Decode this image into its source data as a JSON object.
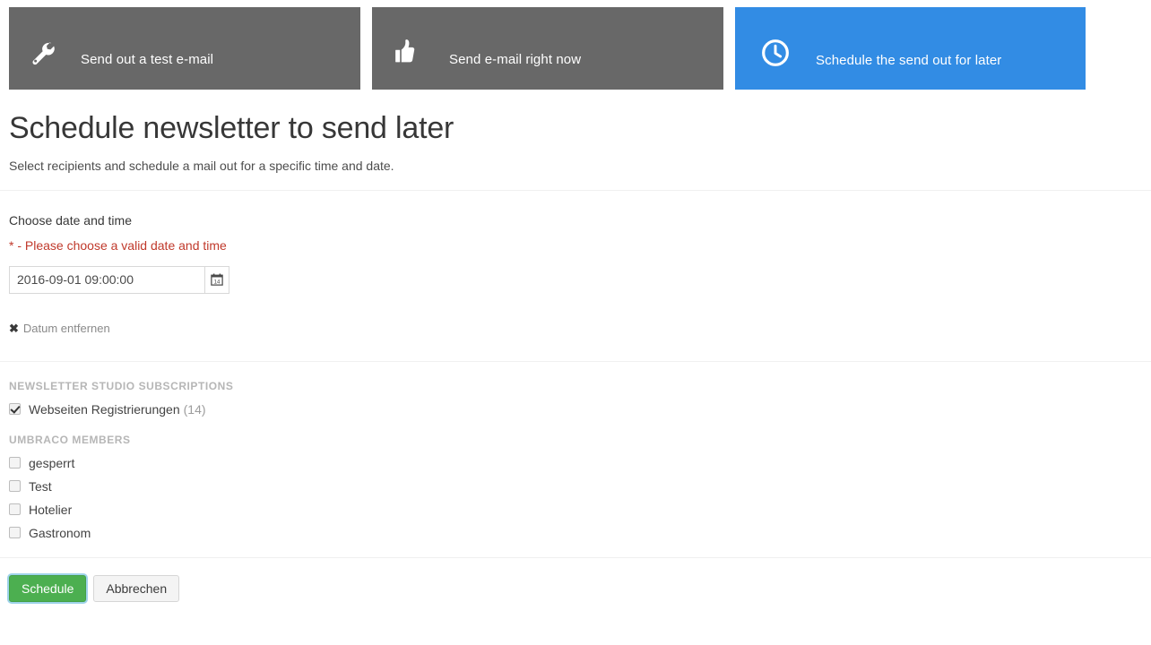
{
  "tiles": [
    {
      "label": "Send out a test e-mail",
      "icon": "wrench-icon",
      "state": "inactive",
      "color": "#686868"
    },
    {
      "label": "Send e-mail right now",
      "icon": "thumbs-up-icon",
      "state": "inactive",
      "color": "#686868"
    },
    {
      "label": "Schedule the send out for later",
      "icon": "clock-icon",
      "state": "active",
      "color": "#328ce4"
    }
  ],
  "page": {
    "title": "Schedule newsletter to send later",
    "subtitle": "Select recipients and schedule a mail out for a specific time and date."
  },
  "date_section": {
    "label": "Choose date and time",
    "error": "* - Please choose a valid date and time",
    "input_value": "2016-09-01 09:00:00",
    "input_placeholder": "",
    "calendar_icon": "calendar-icon",
    "calendar_icon_day": "14",
    "remove_link": "Datum entfernen",
    "remove_icon": "close-icon"
  },
  "groups": [
    {
      "title": "NEWSLETTER STUDIO SUBSCRIPTIONS",
      "items": [
        {
          "label": "Webseiten Registrierungen",
          "count": "(14)",
          "checked": true
        }
      ]
    },
    {
      "title": "UMBRACO MEMBERS",
      "items": [
        {
          "label": "gesperrt",
          "count": "",
          "checked": false
        },
        {
          "label": "Test",
          "count": "",
          "checked": false
        },
        {
          "label": "Hotelier",
          "count": "",
          "checked": false
        },
        {
          "label": "Gastronom",
          "count": "",
          "checked": false
        }
      ]
    }
  ],
  "footer": {
    "primary_label": "Schedule",
    "secondary_label": "Abbrechen",
    "primary_color": "#4caf50"
  }
}
